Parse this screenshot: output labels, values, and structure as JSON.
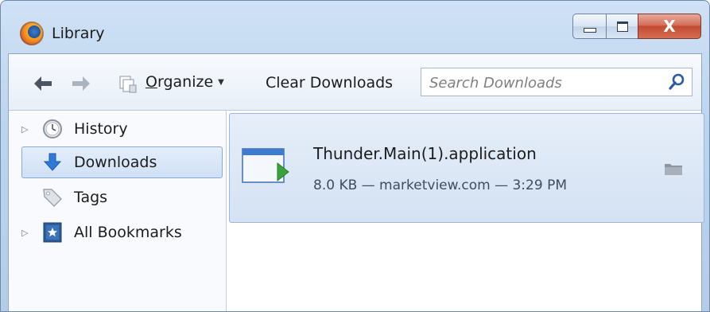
{
  "window": {
    "title": "Library"
  },
  "caption_buttons": {
    "close_label": "X"
  },
  "toolbar": {
    "back_icon": "back-arrow-icon",
    "forward_icon": "forward-arrow-icon",
    "organize_underlined": "O",
    "organize_rest": "rganize",
    "clear_downloads_label": "Clear Downloads",
    "search_placeholder": "Search Downloads"
  },
  "sidebar": {
    "items": [
      {
        "label": "History",
        "icon": "clock-icon",
        "expandable": true,
        "selected": false
      },
      {
        "label": "Downloads",
        "icon": "download-arrow-icon",
        "expandable": false,
        "selected": true
      },
      {
        "label": "Tags",
        "icon": "tag-icon",
        "expandable": false,
        "selected": false
      },
      {
        "label": "All Bookmarks",
        "icon": "bookmark-star-icon",
        "expandable": true,
        "selected": false
      }
    ]
  },
  "downloads": [
    {
      "name": "Thunder.Main(1).application",
      "meta": "8.0 KB — marketview.com — 3:29 PM",
      "icon": "application-file-icon",
      "action_icon": "open-folder-icon"
    }
  ],
  "colors": {
    "selection": "#cfe0f5",
    "close_button": "#c24b33",
    "window_frame": "#bcd5ee"
  }
}
